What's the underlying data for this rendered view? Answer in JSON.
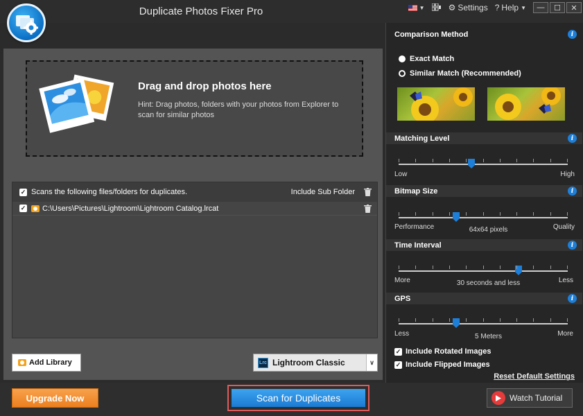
{
  "app": {
    "title": "Duplicate Photos Fixer Pro",
    "logo_icon": "camera-gear-icon",
    "language_icon": "us-flag-icon",
    "settings_label": "Settings",
    "help_label": "Help",
    "window_buttons": [
      "—",
      "☐",
      "✕"
    ]
  },
  "dropzone": {
    "title": "Drag and drop photos here",
    "hint": "Hint: Drag photos, folders with your photos from Explorer to scan for similar photos"
  },
  "file_panel": {
    "header": "Scans the following files/folders for duplicates.",
    "include_sub": "Include Sub Folder",
    "rows": [
      {
        "path": "C:\\Users\\Pictures\\Lightroom\\Lightroom Catalog.lrcat"
      }
    ]
  },
  "add_library": "Add Library",
  "source": {
    "selected": "Lightroom Classic",
    "badge": "Lrc"
  },
  "comparison": {
    "title": "Comparison Method",
    "options": [
      "Exact Match",
      "Similar Match (Recommended)"
    ],
    "selected_index": 0
  },
  "matching_level": {
    "title": "Matching Level",
    "min": "Low",
    "max": "High",
    "position": 0.43
  },
  "bitmap_size": {
    "title": "Bitmap Size",
    "min": "Performance",
    "max": "Quality",
    "value": "64x64 pixels",
    "position": 0.34
  },
  "time_interval": {
    "title": "Time Interval",
    "min": "More",
    "max": "Less",
    "value": "30 seconds and less",
    "position": 0.71
  },
  "gps": {
    "title": "GPS",
    "min": "Less",
    "max": "More",
    "value": "5 Meters",
    "position": 0.34
  },
  "options": {
    "rotated": "Include Rotated Images",
    "flipped": "Include Flipped Images"
  },
  "reset": "Reset Default Settings",
  "bottom": {
    "upgrade": "Upgrade Now",
    "scan": "Scan for Duplicates",
    "tutorial": "Watch Tutorial"
  },
  "colors": {
    "accent": "#1e7fd9",
    "upgrade": "#ec7f1f",
    "scan_highlight": "#e15a5a"
  }
}
